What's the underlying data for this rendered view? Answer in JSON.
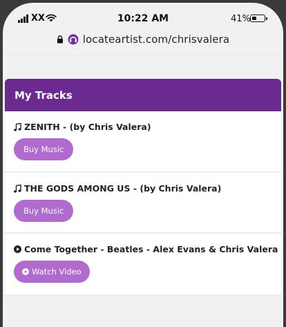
{
  "status_bar": {
    "carrier": "XX",
    "time": "10:22 AM",
    "battery_percent_label": "41%",
    "battery_level": 0.41,
    "icons": [
      "signal-icon",
      "wifi-icon",
      "battery-icon"
    ]
  },
  "browser": {
    "url": "locateartist.com/chrisvalera",
    "icons": [
      "lock-icon",
      "site-icon"
    ]
  },
  "section": {
    "title": "My Tracks",
    "header_color": "#6b2a90",
    "button_color": "#b06ad0"
  },
  "tracks": [
    {
      "icon": "music-note-icon",
      "title": "ZENITH - (by Chris Valera)",
      "button_label": "Buy Music"
    },
    {
      "icon": "music-note-icon",
      "title": "THE GODS AMONG US - (by Chris Valera)",
      "button_label": "Buy Music"
    },
    {
      "icon": "play-circle-icon",
      "title": "Come Together - Beatles - Alex Evans & Chris Valera",
      "button_label": "Watch Video"
    }
  ]
}
